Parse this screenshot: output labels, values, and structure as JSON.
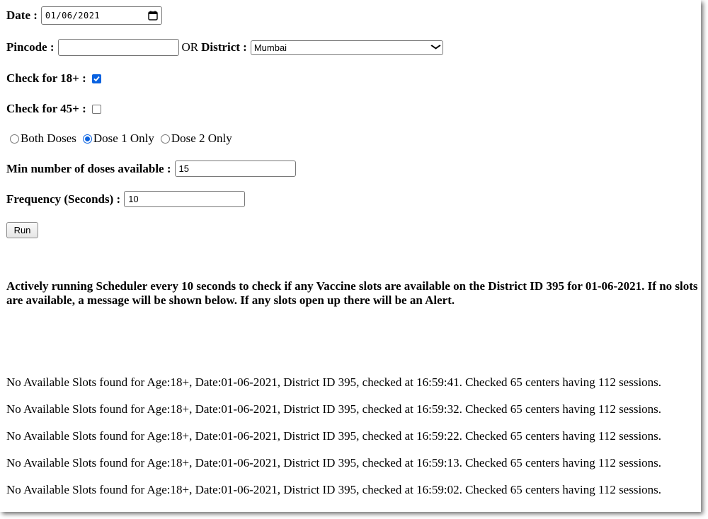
{
  "form": {
    "date": {
      "label": "Date :",
      "value": "01/06/2021"
    },
    "pincode": {
      "label": "Pincode :",
      "value": "",
      "placeholder": ""
    },
    "or_text": "OR",
    "district": {
      "label": "District :",
      "selected": "Mumbai"
    },
    "check18": {
      "label": "Check for 18+ :",
      "checked": true
    },
    "check45": {
      "label": "Check for 45+ :",
      "checked": false
    },
    "dose_options": [
      {
        "label": "Both Doses",
        "selected": false
      },
      {
        "label": "Dose 1 Only",
        "selected": true
      },
      {
        "label": "Dose 2 Only",
        "selected": false
      }
    ],
    "min_doses": {
      "label": "Min number of doses available :",
      "value": "15"
    },
    "frequency": {
      "label": "Frequency (Seconds) :",
      "value": "10"
    },
    "run_label": "Run"
  },
  "status_message": "Actively running Scheduler every 10 seconds to check if any Vaccine slots are available on the District ID 395 for 01-06-2021. If no slots are available, a message will be shown below. If any slots open up there will be an Alert.",
  "log_entries": [
    "No Available Slots found for Age:18+, Date:01-06-2021, District ID 395, checked at 16:59:41. Checked 65 centers having 112 sessions.",
    "No Available Slots found for Age:18+, Date:01-06-2021, District ID 395, checked at 16:59:32. Checked 65 centers having 112 sessions.",
    "No Available Slots found for Age:18+, Date:01-06-2021, District ID 395, checked at 16:59:22. Checked 65 centers having 112 sessions.",
    "No Available Slots found for Age:18+, Date:01-06-2021, District ID 395, checked at 16:59:13. Checked 65 centers having 112 sessions.",
    "No Available Slots found for Age:18+, Date:01-06-2021, District ID 395, checked at 16:59:02. Checked 65 centers having 112 sessions."
  ],
  "icons": {
    "date": "calendar-icon",
    "select": "chevron-down-icon",
    "check": "checkmark-icon"
  },
  "colors": {
    "accent": "#0a62e0"
  }
}
